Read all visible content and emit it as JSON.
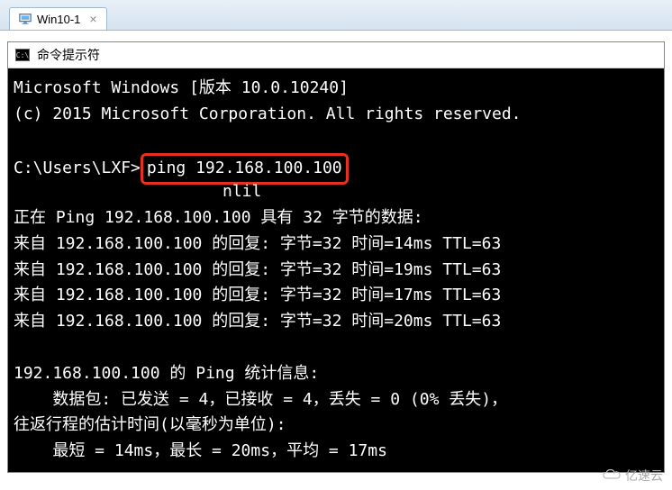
{
  "tab": {
    "label": "Win10-1",
    "close": "×"
  },
  "window": {
    "title": "命令提示符",
    "icon_text": "C:\\"
  },
  "terminal": {
    "line_version": "Microsoft Windows [版本 10.0.10240]",
    "line_copyright": "(c) 2015 Microsoft Corporation. All rights reserved.",
    "blank": "",
    "prompt_prefix": "C:\\Users\\LXF>",
    "command": "ping 192.168.100.100",
    "cursor_line": "nlil",
    "ping_header": "正在 Ping 192.168.100.100 具有 32 字节的数据:",
    "reply1": "来自 192.168.100.100 的回复: 字节=32 时间=14ms TTL=63",
    "reply2": "来自 192.168.100.100 的回复: 字节=32 时间=19ms TTL=63",
    "reply3": "来自 192.168.100.100 的回复: 字节=32 时间=17ms TTL=63",
    "reply4": "来自 192.168.100.100 的回复: 字节=32 时间=20ms TTL=63",
    "stats_header": "192.168.100.100 的 Ping 统计信息:",
    "stats_packets": "    数据包: 已发送 = 4，已接收 = 4，丢失 = 0 (0% 丢失)，",
    "rtt_header": "往返行程的估计时间(以毫秒为单位):",
    "rtt_values": "    最短 = 14ms，最长 = 20ms，平均 = 17ms"
  },
  "watermark": {
    "text": "亿速云"
  }
}
